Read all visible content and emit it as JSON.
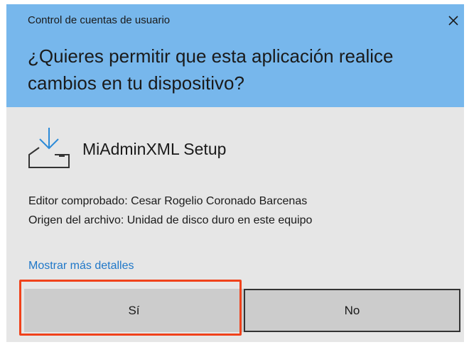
{
  "window": {
    "title": "Control de cuentas de usuario",
    "close_icon": "close-icon"
  },
  "prompt": {
    "question": "¿Quieres permitir que esta aplicación realice cambios en tu dispositivo?"
  },
  "app": {
    "icon": "installer-download-icon",
    "name": "MiAdminXML Setup",
    "publisher_line": "Editor comprobado: Cesar Rogelio Coronado Barcenas",
    "origin_line": "Origen del archivo: Unidad de disco duro en este equipo"
  },
  "details": {
    "link_label": "Mostrar más detalles"
  },
  "buttons": {
    "yes_label": "Sí",
    "no_label": "No"
  },
  "colors": {
    "header_background": "#77b7ec",
    "dialog_background": "#e6e6e6",
    "button_background": "#cccccc",
    "link": "#1f77c8",
    "highlight_outline": "#f0421b"
  }
}
